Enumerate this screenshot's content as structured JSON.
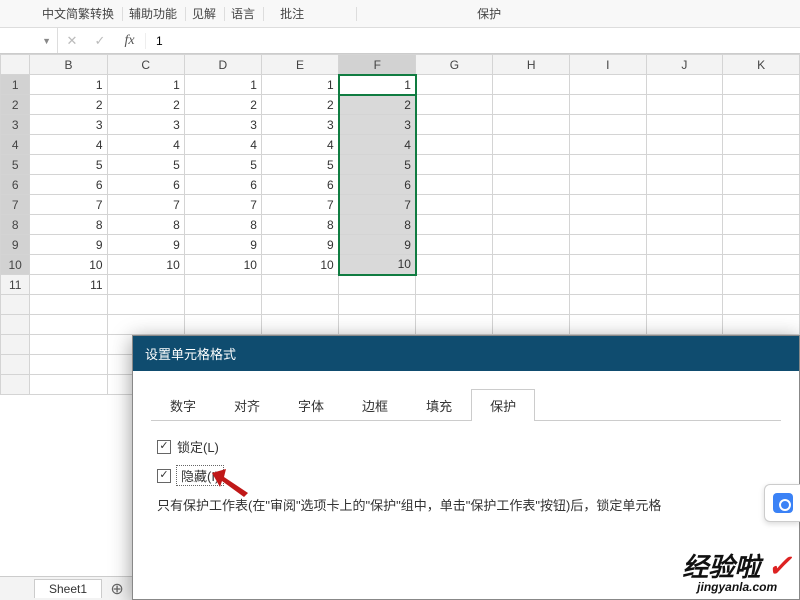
{
  "ribbon": {
    "tabs": [
      "中文简繁转换",
      "辅助功能",
      "见解",
      "语言",
      "批注",
      "保护"
    ]
  },
  "formula_bar": {
    "name_box": "",
    "value": "1"
  },
  "columns": [
    "B",
    "C",
    "D",
    "E",
    "F",
    "G",
    "H",
    "I",
    "J",
    "K"
  ],
  "selected_column_index": 4,
  "rows": [
    {
      "num": 1,
      "cells": [
        "1",
        "1",
        "1",
        "1",
        "1",
        "",
        "",
        "",
        "",
        ""
      ]
    },
    {
      "num": 2,
      "cells": [
        "2",
        "2",
        "2",
        "2",
        "2",
        "",
        "",
        "",
        "",
        ""
      ]
    },
    {
      "num": 3,
      "cells": [
        "3",
        "3",
        "3",
        "3",
        "3",
        "",
        "",
        "",
        "",
        ""
      ]
    },
    {
      "num": 4,
      "cells": [
        "4",
        "4",
        "4",
        "4",
        "4",
        "",
        "",
        "",
        "",
        ""
      ]
    },
    {
      "num": 5,
      "cells": [
        "5",
        "5",
        "5",
        "5",
        "5",
        "",
        "",
        "",
        "",
        ""
      ]
    },
    {
      "num": 6,
      "cells": [
        "6",
        "6",
        "6",
        "6",
        "6",
        "",
        "",
        "",
        "",
        ""
      ]
    },
    {
      "num": 7,
      "cells": [
        "7",
        "7",
        "7",
        "7",
        "7",
        "",
        "",
        "",
        "",
        ""
      ]
    },
    {
      "num": 8,
      "cells": [
        "8",
        "8",
        "8",
        "8",
        "8",
        "",
        "",
        "",
        "",
        ""
      ]
    },
    {
      "num": 9,
      "cells": [
        "9",
        "9",
        "9",
        "9",
        "9",
        "",
        "",
        "",
        "",
        ""
      ]
    },
    {
      "num": 10,
      "cells": [
        "10",
        "10",
        "10",
        "10",
        "10",
        "",
        "",
        "",
        "",
        ""
      ]
    },
    {
      "num": 11,
      "cells": [
        "11",
        "",
        "",
        "",
        "",
        "",
        "",
        "",
        "",
        ""
      ]
    }
  ],
  "sheet_tab": {
    "name": "Sheet1"
  },
  "dialog": {
    "title": "设置单元格格式",
    "tabs": [
      "数字",
      "对齐",
      "字体",
      "边框",
      "填充",
      "保护"
    ],
    "active_tab_index": 5,
    "lock_label": "锁定(L)",
    "hide_label": "隐藏(I)",
    "lock_checked": true,
    "hide_checked": true,
    "note": "只有保护工作表(在\"审阅\"选项卡上的\"保护\"组中，单击\"保护工作表\"按钮)后，锁定单元格"
  },
  "watermark": {
    "line1": "经验啦",
    "line2": "jingyanla.com"
  }
}
